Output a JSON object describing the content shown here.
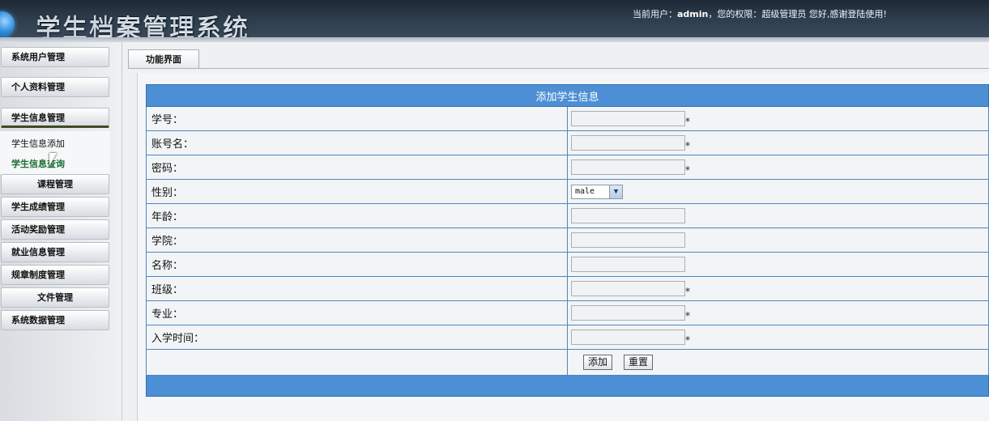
{
  "header": {
    "title": "学生档案管理系统",
    "user_prefix": "当前用户：",
    "username": "admin",
    "user_suffix": "，您的权限：超级管理员 您好,感谢登陆使用!"
  },
  "sidebar": {
    "items": [
      {
        "label": "系统用户管理"
      },
      {
        "label": "个人资料管理"
      },
      {
        "label": "学生信息管理"
      },
      {
        "label": "课程管理"
      },
      {
        "label": "学生成绩管理"
      },
      {
        "label": "活动奖励管理"
      },
      {
        "label": "就业信息管理"
      },
      {
        "label": "规章制度管理"
      },
      {
        "label": "文件管理"
      },
      {
        "label": "系统数据管理"
      }
    ],
    "submenu": [
      {
        "label": "学生信息添加"
      },
      {
        "label": "学生信息查询"
      }
    ]
  },
  "main": {
    "tab_label": "功能界面",
    "form": {
      "title": "添加学生信息",
      "required_mark": "*",
      "fields": [
        {
          "label": "学号：",
          "value": ""
        },
        {
          "label": "账号名：",
          "value": ""
        },
        {
          "label": "密码：",
          "value": ""
        },
        {
          "label": "性别：",
          "value": "male"
        },
        {
          "label": "年龄：",
          "value": ""
        },
        {
          "label": "学院：",
          "value": ""
        },
        {
          "label": "名称：",
          "value": ""
        },
        {
          "label": "班级：",
          "value": ""
        },
        {
          "label": "专业：",
          "value": ""
        },
        {
          "label": "入学时间：",
          "value": ""
        }
      ],
      "submit_label": "添加",
      "reset_label": "重置"
    }
  }
}
